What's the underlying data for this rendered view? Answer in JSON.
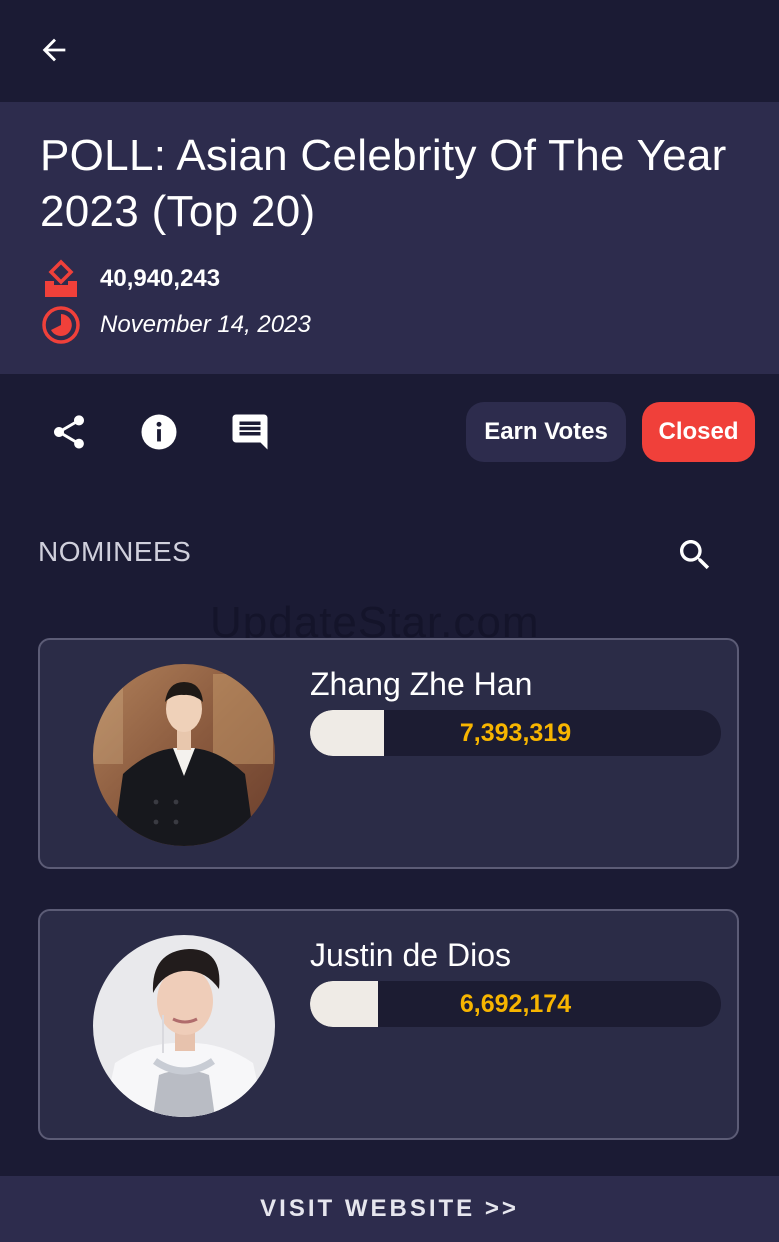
{
  "nav": {
    "back_icon": "arrow-left-icon"
  },
  "poll": {
    "title": "POLL: Asian Celebrity Of The Year 2023 (Top 20)",
    "total_votes": "40,940,243",
    "date": "November 14, 2023",
    "votes_icon": "ballot-box-icon",
    "date_icon": "clock-icon"
  },
  "actions": {
    "share_icon": "share-icon",
    "info_icon": "info-icon",
    "comments_icon": "comment-icon",
    "earn_votes_label": "Earn Votes",
    "status_label": "Closed"
  },
  "nominees_section": {
    "label": "NOMINEES",
    "search_icon": "search-icon",
    "watermark": "UpdateStar.com"
  },
  "nominees": [
    {
      "name": "Zhang Zhe Han",
      "votes": "7,393,319",
      "bar_fill_fraction": 0.18
    },
    {
      "name": "Justin de Dios",
      "votes": "6,692,174",
      "bar_fill_fraction": 0.165
    }
  ],
  "footer": {
    "label": "VISIT WEBSITE >>"
  },
  "colors": {
    "background": "#1b1b34",
    "header": "#2d2c4d",
    "accent_red": "#f0403a",
    "vote_count": "#f7b500"
  }
}
